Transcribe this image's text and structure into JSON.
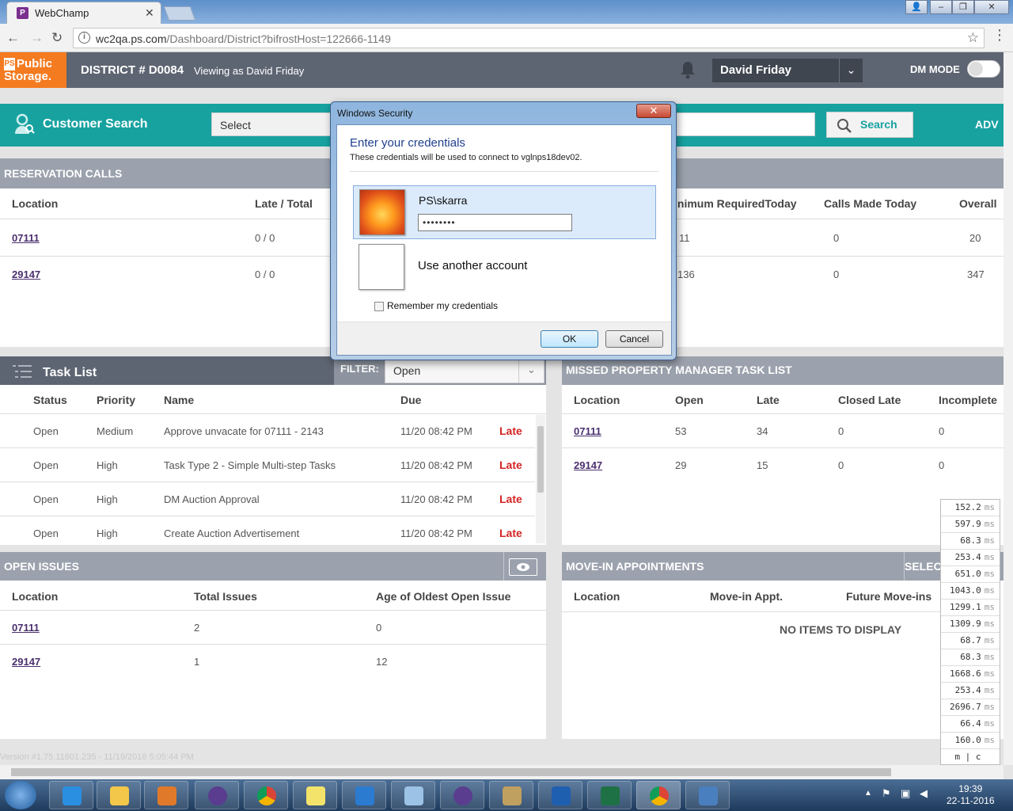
{
  "browser": {
    "tab_title": "WebChamp",
    "url_host": "wc2qa.ps.com",
    "url_path": "/Dashboard/District?bifrostHost=122666-1149"
  },
  "header": {
    "logo_line1": "Public",
    "logo_line2": "Storage.",
    "district": "DISTRICT # D0084",
    "viewing_as": "Viewing as David Friday",
    "user_name": "David Friday",
    "dm_mode_label": "DM MODE"
  },
  "customer_search": {
    "title": "Customer Search",
    "select_value": "Select",
    "search_button": "Search",
    "advanced": "ADV"
  },
  "reservation_calls": {
    "title": "RESERVATION CALLS",
    "columns": [
      "Location",
      "Late / Total",
      "inimum RequiredToday",
      "Calls Made Today",
      "Overall"
    ],
    "rows": [
      {
        "location": "07111",
        "late_total": "0 / 0",
        "min_required": "11",
        "calls_made": "0",
        "overall": "20"
      },
      {
        "location": "29147",
        "late_total": "0 / 0",
        "min_required": "136",
        "calls_made": "0",
        "overall": "347"
      }
    ]
  },
  "task_list": {
    "title": "Task List",
    "filter_label": "FILTER:",
    "filter_value": "Open",
    "columns": [
      "Status",
      "Priority",
      "Name",
      "Due"
    ],
    "rows": [
      {
        "status": "Open",
        "priority": "Medium",
        "name": "Approve unvacate for 07111 - 2143",
        "due": "11/20 08:42 PM",
        "flag": "Late"
      },
      {
        "status": "Open",
        "priority": "High",
        "name": "Task Type 2 - Simple Multi-step Tasks",
        "due": "11/20 08:42 PM",
        "flag": "Late"
      },
      {
        "status": "Open",
        "priority": "High",
        "name": "DM Auction Approval",
        "due": "11/20 08:42 PM",
        "flag": "Late"
      },
      {
        "status": "Open",
        "priority": "High",
        "name": "Create Auction Advertisement",
        "due": "11/20 08:42 PM",
        "flag": "Late"
      }
    ]
  },
  "missed_tasks": {
    "title": "MISSED PROPERTY MANAGER TASK LIST",
    "columns": [
      "Location",
      "Open",
      "Late",
      "Closed Late",
      "Incomplete"
    ],
    "rows": [
      {
        "location": "07111",
        "open": "53",
        "late": "34",
        "closed_late": "0",
        "incomplete": "0"
      },
      {
        "location": "29147",
        "open": "29",
        "late": "15",
        "closed_late": "0",
        "incomplete": "0"
      }
    ]
  },
  "open_issues": {
    "title": "OPEN ISSUES",
    "columns": [
      "Location",
      "Total Issues",
      "Age of Oldest Open Issue"
    ],
    "rows": [
      {
        "location": "07111",
        "total": "2",
        "age": "0"
      },
      {
        "location": "29147",
        "total": "1",
        "age": "12"
      }
    ]
  },
  "move_in": {
    "title": "MOVE-IN APPOINTMENTS",
    "select": "SELEC",
    "columns": [
      "Location",
      "Move-in Appt.",
      "Future Move-ins"
    ],
    "empty": "NO ITEMS TO DISPLAY"
  },
  "dialog": {
    "title": "Windows Security",
    "heading": "Enter your credentials",
    "subtext": "These credentials will be used to connect to vglnps18dev02.",
    "username": "PS\\skarra",
    "password": "••••••••",
    "other_account": "Use another account",
    "remember": "Remember my credentials",
    "ok": "OK",
    "cancel": "Cancel"
  },
  "timings": [
    "152.2",
    "597.9",
    "68.3",
    "253.4",
    "651.0",
    "1043.0",
    "1299.1",
    "1309.9",
    "68.7",
    "68.3",
    "1668.6",
    "253.4",
    "2696.7",
    "66.4",
    "160.0"
  ],
  "timing_unit": "ms",
  "timing_footer": "m | c",
  "version": "Version #1.75.11601.235 - 11/19/2016 5:05:44 PM",
  "clock": {
    "time": "19:39",
    "date": "22-11-2016"
  }
}
